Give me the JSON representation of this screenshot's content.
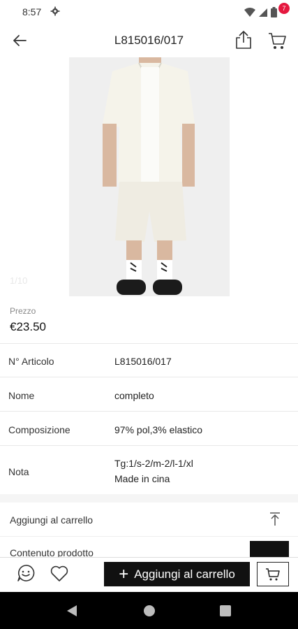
{
  "status_bar": {
    "time": "8:57",
    "icons": [
      "gear-icon",
      "wifi-icon",
      "signal-icon",
      "battery-icon"
    ]
  },
  "header": {
    "title": "L815016/017",
    "cart_count": "7",
    "icons": [
      "back-arrow-icon",
      "share-icon",
      "cart-icon"
    ]
  },
  "gallery": {
    "pager": "1/10"
  },
  "price": {
    "label": "Prezzo",
    "value": "€23.50"
  },
  "details": [
    {
      "label": "N° Articolo",
      "value": "L815016/017"
    },
    {
      "label": "Nome",
      "value": "completo"
    },
    {
      "label": "Composizione",
      "value": "97% pol,3% elastico"
    },
    {
      "label": "Nota",
      "value_line1": "Tg:1/s-2/m-2/l-1/xl",
      "value_line2": "Made in cina"
    }
  ],
  "add_to_cart_section": {
    "label": "Aggiungi al carrello"
  },
  "peek_section": {
    "label": "Contenuto prodotto"
  },
  "bottom_bar": {
    "add_to_cart_label": "Aggiungi al carrello",
    "icons": [
      "chat-icon",
      "heart-icon",
      "plus-icon",
      "cart-icon"
    ]
  },
  "colors": {
    "accent_badge": "#e5183f",
    "primary_button": "#111111"
  }
}
